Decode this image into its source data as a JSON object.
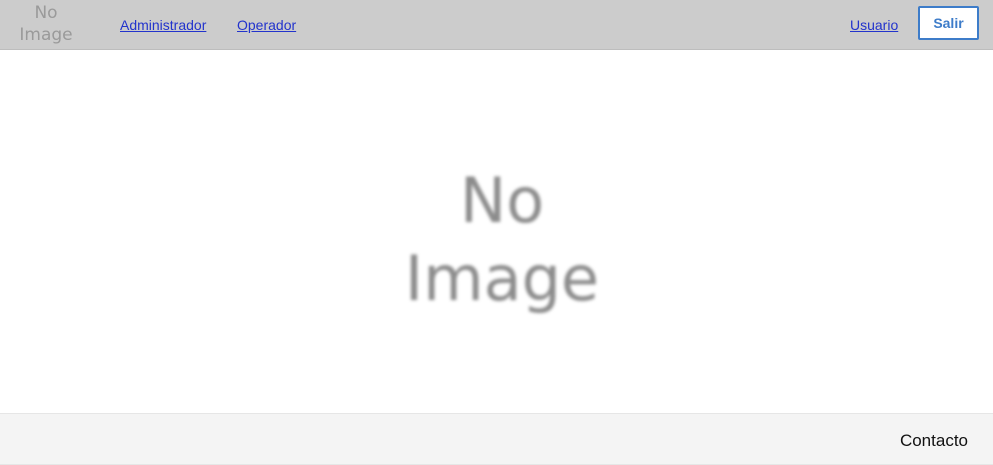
{
  "header": {
    "logo_line1": "No",
    "logo_line2": "Image",
    "nav": {
      "admin_label": "Administrador",
      "operador_label": "Operador"
    },
    "user_label": "Usuario",
    "logout_label": "Salir"
  },
  "main": {
    "image_line1": "No",
    "image_line2": "Image"
  },
  "footer": {
    "contact_label": "Contacto"
  },
  "colors": {
    "header_bg": "#cccccc",
    "link": "#2233cc",
    "button_accent": "#3d7cc9",
    "footer_bg": "#f4f4f4"
  }
}
